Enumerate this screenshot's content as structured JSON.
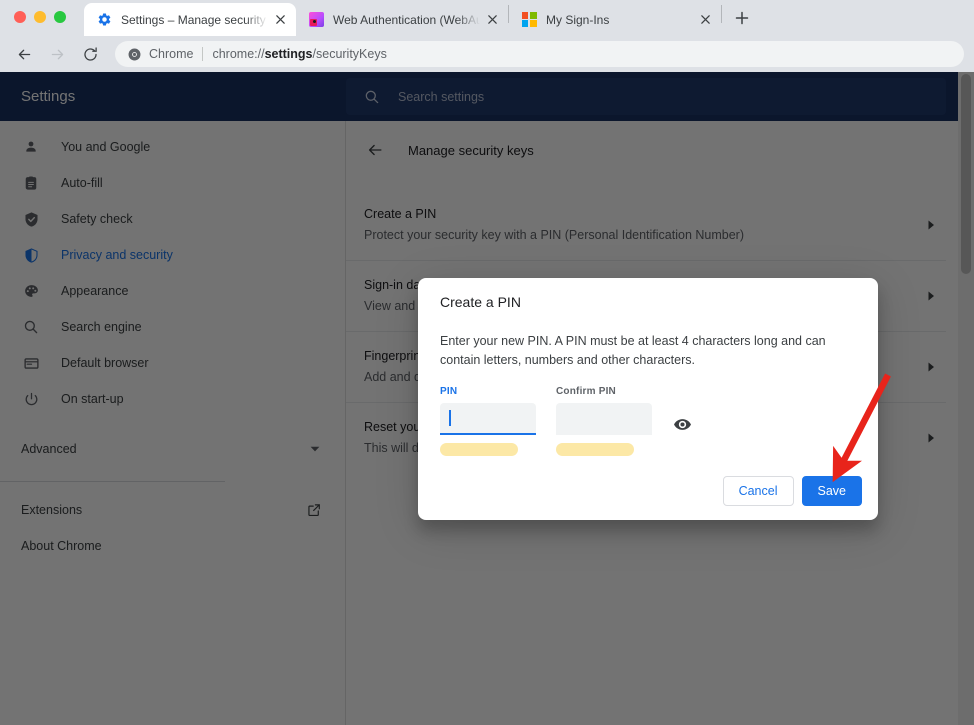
{
  "window": {
    "traffic_lights": [
      "close",
      "minimize",
      "maximize"
    ]
  },
  "tabs": [
    {
      "title": "Settings – Manage security key",
      "favicon": "gear-icon",
      "active": true,
      "close_label": "×"
    },
    {
      "title": "Web Authentication (WebAuthn",
      "favicon": "webauthn-icon",
      "active": false,
      "close_label": "×"
    },
    {
      "title": "My Sign-Ins",
      "favicon": "microsoft-icon",
      "active": false,
      "close_label": "×"
    }
  ],
  "new_tab_label": "+",
  "toolbar": {
    "back_label": "←",
    "forward_label": "→",
    "reload_label": "↻",
    "omnibox": {
      "scheme_chip": "Chrome",
      "url_prefix": "chrome://",
      "url_bold": "settings",
      "url_suffix": "/securityKeys"
    }
  },
  "settings": {
    "title": "Settings",
    "search": {
      "placeholder": "Search settings",
      "value": "",
      "icon": "search-icon"
    },
    "sidebar": {
      "items": [
        {
          "label": "You and Google",
          "icon": "person-icon",
          "selected": false
        },
        {
          "label": "Auto-fill",
          "icon": "clipboard-icon",
          "selected": false
        },
        {
          "label": "Safety check",
          "icon": "shield-check-icon",
          "selected": false
        },
        {
          "label": "Privacy and security",
          "icon": "shield-icon",
          "selected": true
        },
        {
          "label": "Appearance",
          "icon": "palette-icon",
          "selected": false
        },
        {
          "label": "Search engine",
          "icon": "search-icon",
          "selected": false
        },
        {
          "label": "Default browser",
          "icon": "browser-window-icon",
          "selected": false
        },
        {
          "label": "On start-up",
          "icon": "power-icon",
          "selected": false
        }
      ],
      "advanced": {
        "label": "Advanced",
        "icon": "chevron-down-icon"
      },
      "links": [
        {
          "label": "Extensions",
          "icon": "external-link-icon"
        },
        {
          "label": "About Chrome",
          "icon": ""
        }
      ]
    },
    "main": {
      "back_icon": "back-arrow-icon",
      "heading": "Manage security keys",
      "rows": [
        {
          "title": "Create a PIN",
          "subtitle": "Protect your security key with a PIN (Personal Identification Number)",
          "chevron": "chevron-right-icon"
        },
        {
          "title": "Sign-in data",
          "subtitle": "View and c",
          "chevron": "chevron-right-icon"
        },
        {
          "title": "Fingerprin",
          "subtitle": "Add and d",
          "chevron": "chevron-right-icon"
        },
        {
          "title": "Reset your",
          "subtitle": "This will d",
          "chevron": "chevron-right-icon"
        }
      ]
    }
  },
  "dialog": {
    "title": "Create a PIN",
    "body": "Enter your new PIN. A PIN must be at least 4 characters long and can contain letters, numbers and other characters.",
    "fields": [
      {
        "label": "PIN",
        "value": "",
        "focused": true,
        "autofill_suggestion": true
      },
      {
        "label": "Confirm PIN",
        "value": "",
        "focused": false,
        "autofill_suggestion": true
      }
    ],
    "show_password_icon": "eye-icon",
    "buttons": {
      "cancel": "Cancel",
      "save": "Save"
    }
  },
  "annotation": {
    "arrow": {
      "color": "#e8241b",
      "points_to": "save-button"
    }
  },
  "colors": {
    "chrome_frame": "#dee1e6",
    "settings_header": "#1a3263",
    "accent_blue": "#1a73e8",
    "autofill_yellow": "#fce8a6",
    "scrim": "rgba(0,0,0,0.55)"
  }
}
